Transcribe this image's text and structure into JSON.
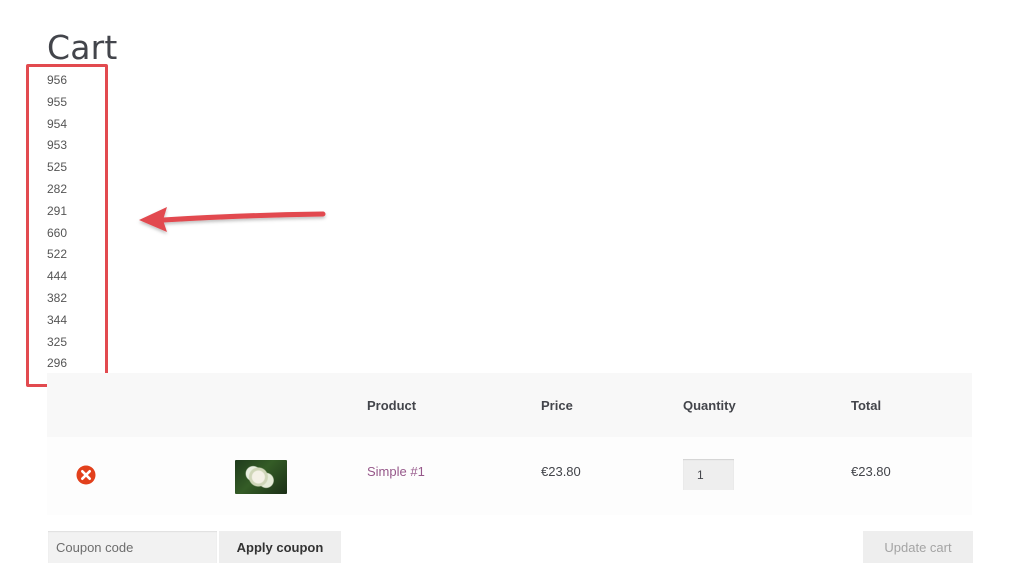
{
  "page": {
    "title": "Cart"
  },
  "id_list": [
    "956",
    "955",
    "954",
    "953",
    "525",
    "282",
    "291",
    "660",
    "522",
    "444",
    "382",
    "344",
    "325",
    "296"
  ],
  "annotation": {
    "box_color": "#e24a4f"
  },
  "table": {
    "headers": {
      "product": "Product",
      "price": "Price",
      "quantity": "Quantity",
      "total": "Total"
    },
    "rows": [
      {
        "name": "Simple #1",
        "price": "€23.80",
        "quantity": "1",
        "total": "€23.80"
      }
    ]
  },
  "coupon": {
    "placeholder": "Coupon code",
    "apply_label": "Apply coupon"
  },
  "update_label": "Update cart",
  "colors": {
    "link": "#96588a",
    "remove": "#e2401c",
    "header_bg": "#f8f8f8"
  }
}
